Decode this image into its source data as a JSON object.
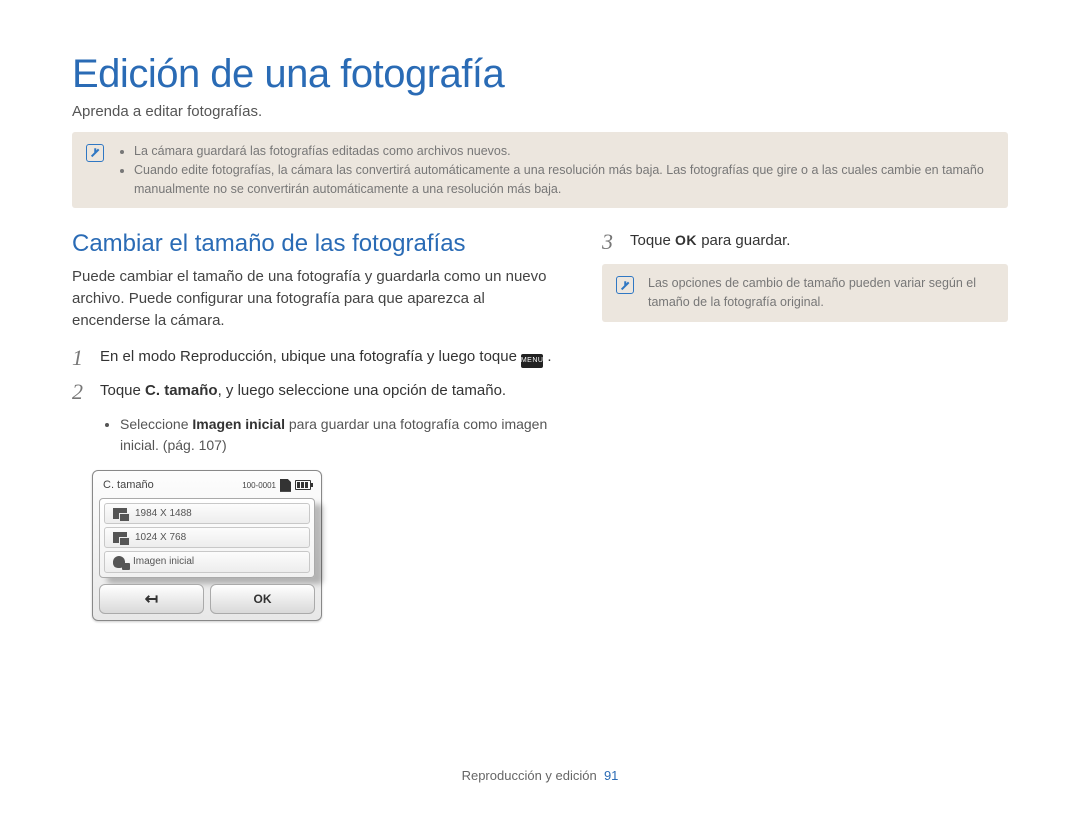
{
  "title": "Edición de una fotografía",
  "intro": "Aprenda a editar fotografías.",
  "top_notes": [
    "La cámara guardará las fotografías editadas como archivos nuevos.",
    "Cuando edite fotografías, la cámara las convertirá automáticamente a una resolución más baja. Las fotografías que gire o a las cuales cambie en tamaño manualmente no se convertirán automáticamente a una resolución más baja."
  ],
  "section_title": "Cambiar el tamaño de las fotografías",
  "section_body": "Puede cambiar el tamaño de una fotografía y guardarla como un nuevo archivo. Puede configurar una fotografía para que aparezca al encenderse la cámara.",
  "step1_a": "En el modo Reproducción, ubique una fotografía y luego toque ",
  "step1_b": ".",
  "menu_chip": "MENU",
  "step2_a": "Toque ",
  "step2_bold": "C. tamaño",
  "step2_b": ", y luego seleccione una opción de tamaño.",
  "sub_a": "Seleccione ",
  "sub_bold": "Imagen inicial",
  "sub_b": " para guardar una fotografía como imagen inicial. (pág. 107)",
  "device": {
    "title": "C. tamaño",
    "counter": "100-0001",
    "rows": [
      "1984 X 1488",
      "1024 X 768",
      "Imagen inicial"
    ],
    "ok": "OK",
    "back": "↤"
  },
  "step3_a": "Toque ",
  "step3_ok": "OK",
  "step3_b": " para guardar.",
  "right_note": "Las opciones de cambio de tamaño pueden variar según el tamaño de la fotografía original.",
  "footer_text": "Reproducción y edición",
  "footer_page": "91"
}
